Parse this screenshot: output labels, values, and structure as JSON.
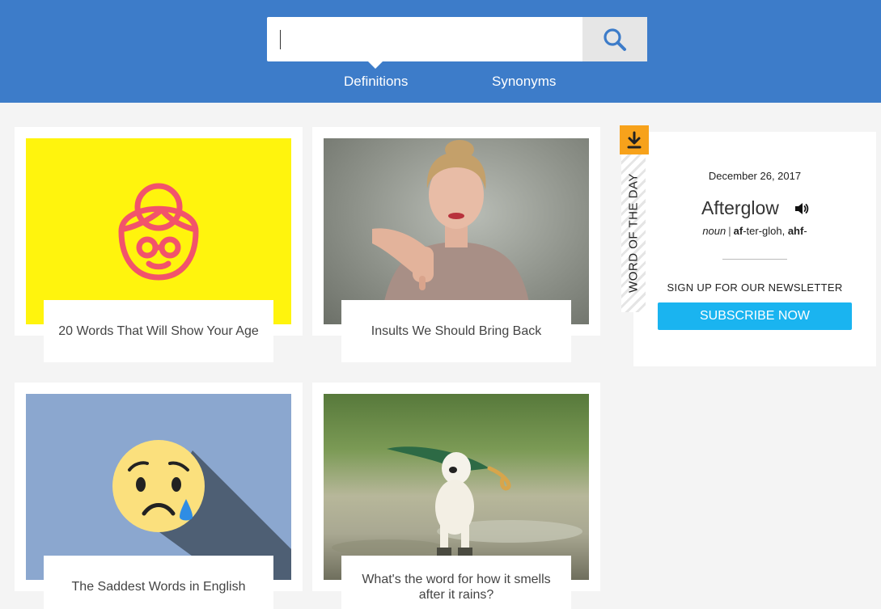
{
  "search": {
    "value": "",
    "placeholder": ""
  },
  "tabs": [
    {
      "label": "Definitions",
      "active": true
    },
    {
      "label": "Synonyms",
      "active": false
    }
  ],
  "cards": [
    {
      "caption": "20 Words That Will Show Your Age",
      "image": "old-woman-face-icon-on-yellow"
    },
    {
      "caption": "Insults We Should Bring Back",
      "image": "woman-thumbs-down-photo"
    },
    {
      "caption": "The Saddest Words in English",
      "image": "crying-emoji-on-blue"
    },
    {
      "caption": "What's the word for how it smells after it rains?",
      "image": "dog-holding-umbrella-in-rain-photo"
    }
  ],
  "word_of_the_day": {
    "ribbon_label": "WORD OF THE DAY",
    "date": "December 26, 2017",
    "word": "Afterglow",
    "part_of_speech": "noun",
    "pronunciation_bold_1": "af",
    "pronunciation_mid": "-ter-gloh, ",
    "pronunciation_bold_2": "ahf",
    "pronunciation_end": "-",
    "newsletter_label": "SIGN UP FOR OUR NEWSLETTER",
    "subscribe_label": "SUBSCRIBE NOW"
  },
  "colors": {
    "header_bg": "#3d7cc9",
    "subscribe_bg": "#1ab4f0",
    "download_badge": "#f7a21b"
  },
  "icons": [
    "search-icon",
    "download-icon",
    "speaker-icon"
  ]
}
